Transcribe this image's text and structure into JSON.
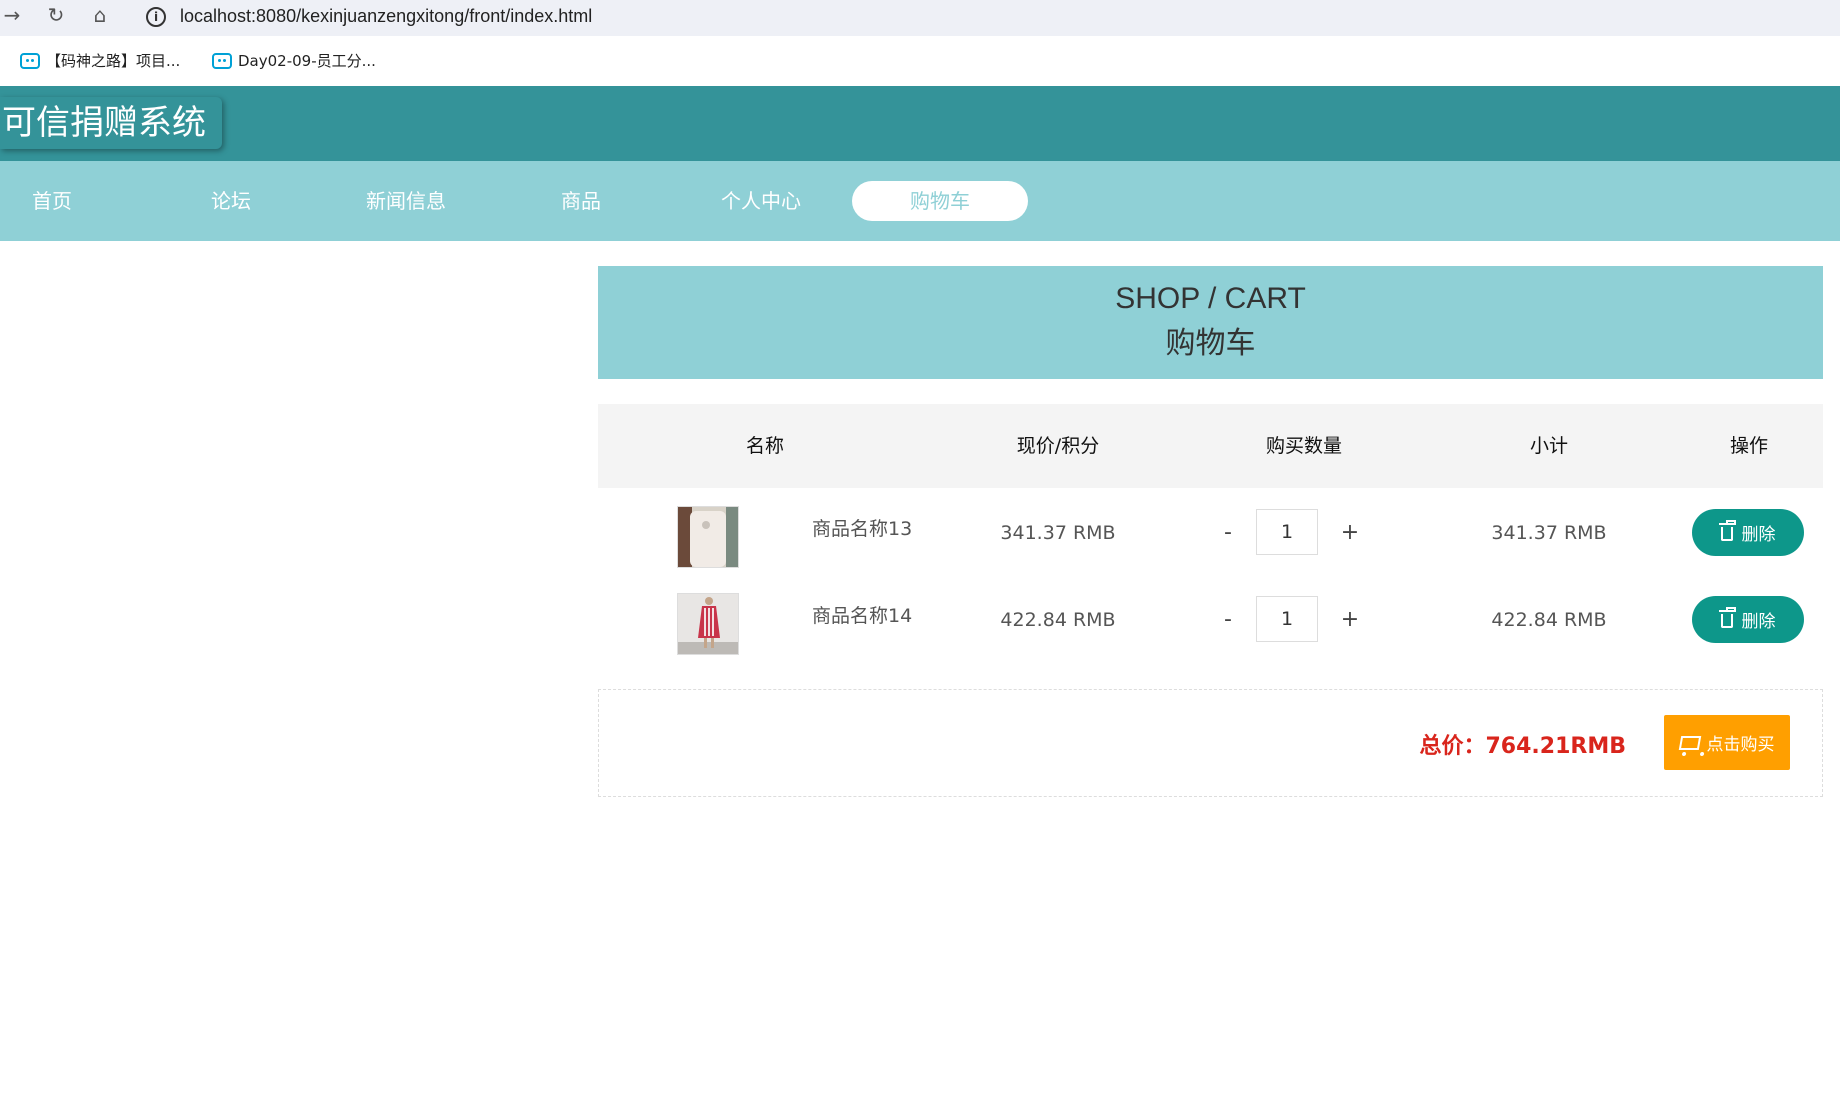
{
  "browser": {
    "url": "localhost:8080/kexinjuanzengxitong/front/index.html",
    "bookmarks": [
      {
        "label": "【码神之路】项目..."
      },
      {
        "label": "Day02-09-员工分..."
      }
    ]
  },
  "site": {
    "logo": "可信捐赠系统",
    "nav": [
      {
        "label": "首页"
      },
      {
        "label": "论坛"
      },
      {
        "label": "新闻信息"
      },
      {
        "label": "商品"
      },
      {
        "label": "个人中心"
      },
      {
        "label": "购物车",
        "active": true
      }
    ]
  },
  "cart": {
    "banner_en": "SHOP / CART",
    "banner_zh": "购物车",
    "headers": {
      "name": "名称",
      "price": "现价/积分",
      "quantity": "购买数量",
      "subtotal": "小计",
      "action": "操作"
    },
    "items": [
      {
        "name": "商品名称13",
        "price": "341.37 RMB",
        "minus": "-",
        "quantity": "1",
        "plus": "+",
        "subtotal": "341.37 RMB",
        "delete_label": "删除"
      },
      {
        "name": "商品名称14",
        "price": "422.84 RMB",
        "minus": "-",
        "quantity": "1",
        "plus": "+",
        "subtotal": "422.84 RMB",
        "delete_label": "删除"
      }
    ],
    "total_label": "总价：764.21RMB",
    "buy_label": "点击购买"
  },
  "colors": {
    "header": "#349399",
    "nav": "#8fd0d6",
    "delete": "#0d978a",
    "buy": "#ff9f00",
    "total": "#d9251c"
  }
}
